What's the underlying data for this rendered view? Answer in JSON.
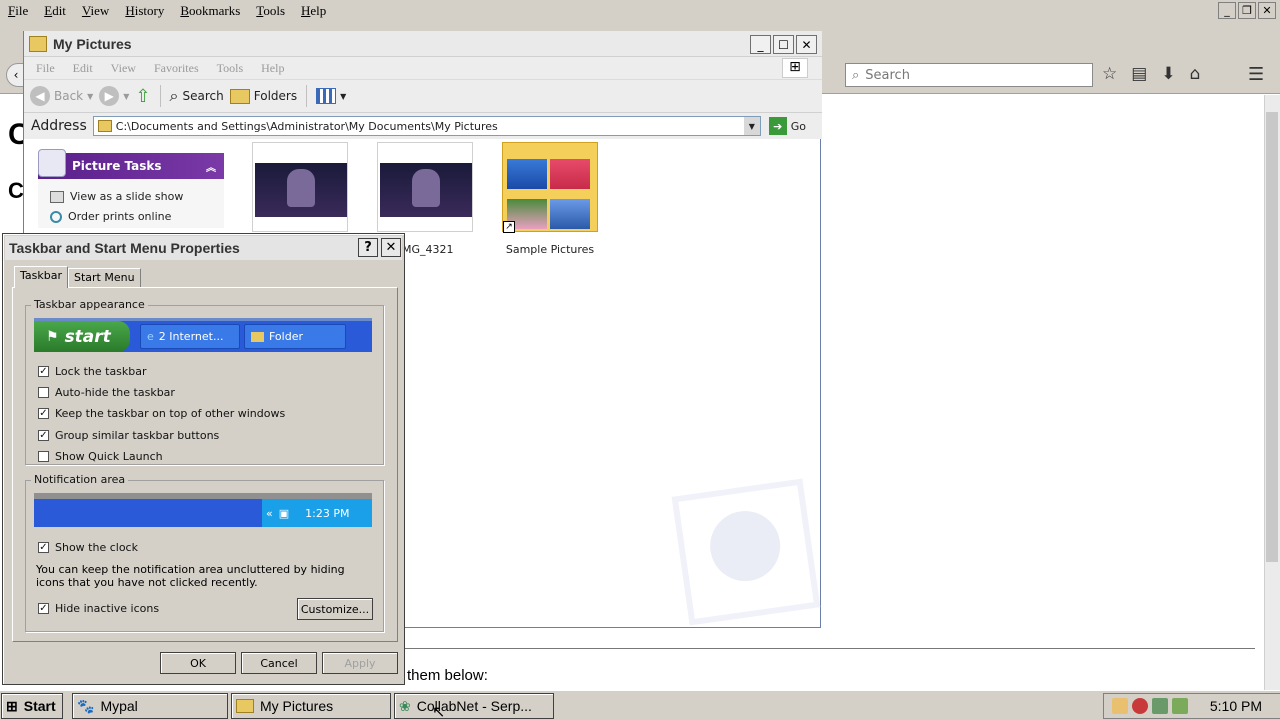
{
  "firefox": {
    "menu": [
      "File",
      "Edit",
      "View",
      "History",
      "Bookmarks",
      "Tools",
      "Help"
    ],
    "search_placeholder": "Search",
    "page_text": "them below:"
  },
  "explorer": {
    "title": "My Pictures",
    "menu": [
      "File",
      "Edit",
      "View",
      "Favorites",
      "Tools",
      "Help"
    ],
    "toolbar": {
      "back": "Back",
      "search": "Search",
      "folders": "Folders"
    },
    "address_label": "Address",
    "address_value": "C:\\Documents and Settings\\Administrator\\My Documents\\My Pictures",
    "go_label": "Go",
    "tasks_title": "Picture Tasks",
    "tasks": [
      "View as a slide show",
      "Order prints online"
    ],
    "files": [
      {
        "label": "",
        "kind": "image"
      },
      {
        "label": "MG_4321",
        "kind": "image"
      },
      {
        "label": "Sample Pictures",
        "kind": "folder"
      }
    ]
  },
  "dialog": {
    "title": "Taskbar and Start Menu Properties",
    "tabs": [
      "Taskbar",
      "Start Menu"
    ],
    "appearance_label": "Taskbar appearance",
    "preview": {
      "start": "start",
      "btn1": "2 Internet...",
      "btn2": "Folder"
    },
    "options": [
      {
        "label": "Lock the taskbar",
        "checked": true
      },
      {
        "label": "Auto-hide the taskbar",
        "checked": false
      },
      {
        "label": "Keep the taskbar on top of other windows",
        "checked": true
      },
      {
        "label": "Group similar taskbar buttons",
        "checked": true
      },
      {
        "label": "Show Quick Launch",
        "checked": false
      }
    ],
    "notification_label": "Notification area",
    "tray_time": "1:23 PM",
    "show_clock": {
      "label": "Show the clock",
      "checked": true
    },
    "hint": "You can keep the notification area uncluttered by hiding icons that you have not clicked recently.",
    "hide_inactive": {
      "label": "Hide inactive icons",
      "checked": true
    },
    "customize": "Customize...",
    "ok": "OK",
    "cancel": "Cancel",
    "apply": "Apply"
  },
  "taskbar": {
    "start": "Start",
    "items": [
      "Mypal",
      "My Pictures",
      "CollabNet - Serp..."
    ],
    "clock": "5:10 PM"
  }
}
